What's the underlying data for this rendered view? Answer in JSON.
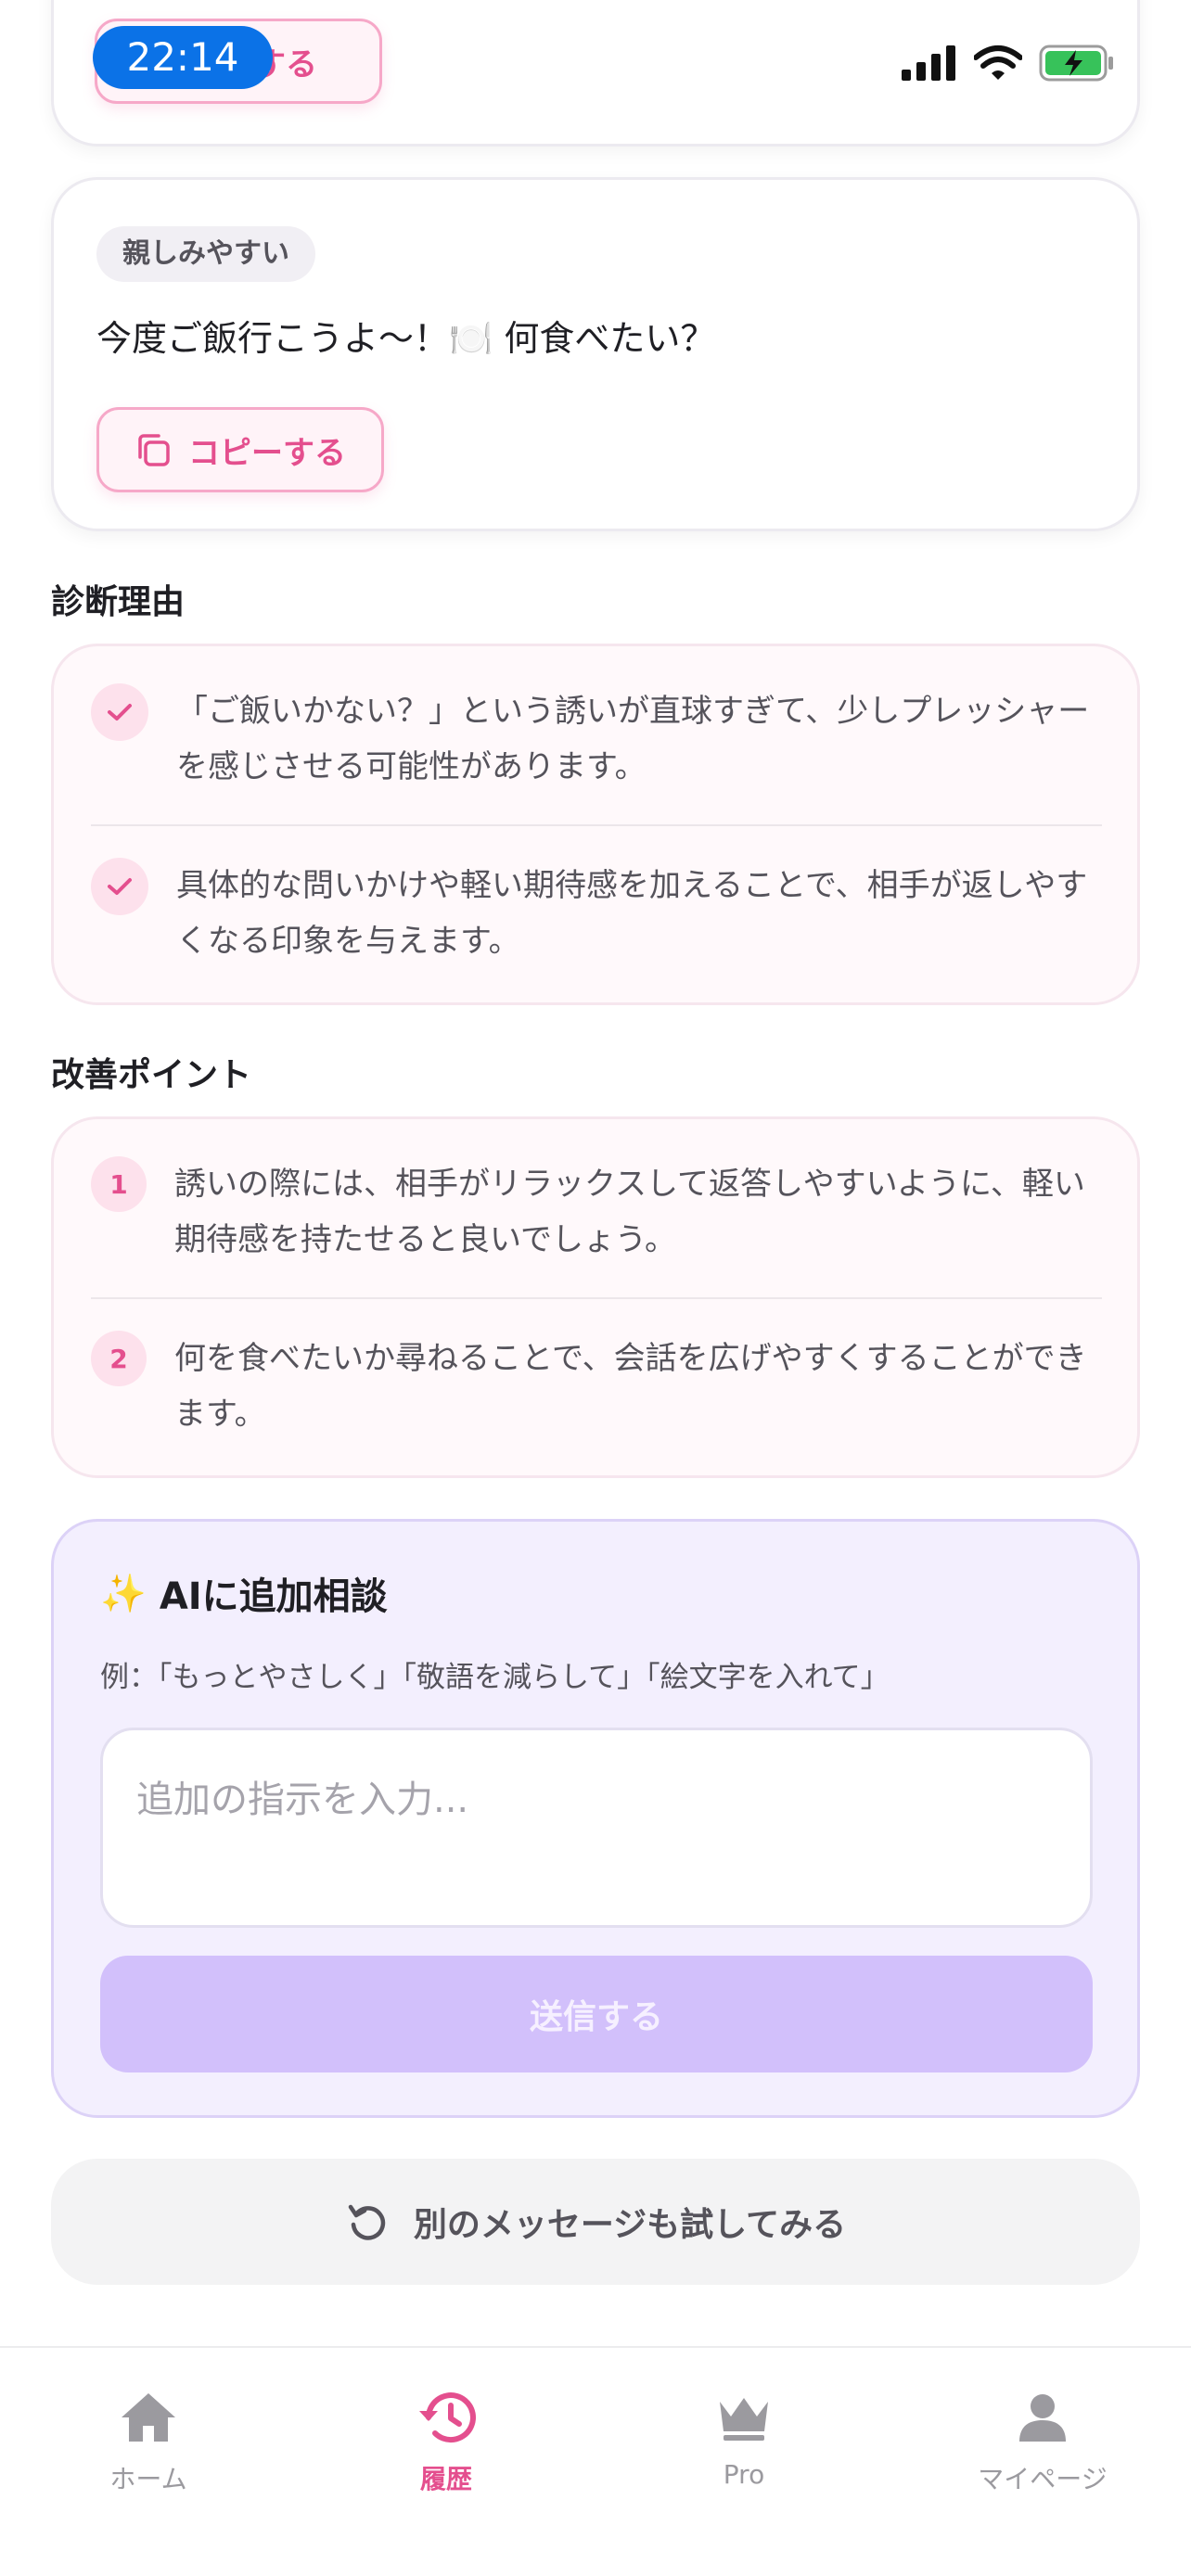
{
  "status": {
    "time": "22:14"
  },
  "top_card": {
    "copy_label": "コピーする"
  },
  "suggestion_card": {
    "tag": "親しみやすい",
    "message": "今度ご飯行こうよ〜！🍽️ 何食べたい？",
    "copy_label": "コピーする"
  },
  "reasons": {
    "title": "診断理由",
    "items": [
      "「ご飯いかない？」という誘いが直球すぎて、少しプレッシャーを感じさせる可能性があります。",
      "具体的な問いかけや軽い期待感を加えることで、相手が返しやすくなる印象を与えます。"
    ]
  },
  "improvements": {
    "title": "改善ポイント",
    "items": [
      {
        "num": "1",
        "text": "誘いの際には、相手がリラックスして返答しやすいように、軽い期待感を持たせると良いでしょう。"
      },
      {
        "num": "2",
        "text": "何を食べたいか尋ねることで、会話を広げやすくすることができます。"
      }
    ]
  },
  "ai": {
    "title": "AIに追加相談",
    "emoji": "✨",
    "examples": "例：「もっとやさしく」「敬語を減らして」「絵文字を入れて」",
    "placeholder": "追加の指示を入力...",
    "send_label": "送信する"
  },
  "retry_label": "別のメッセージも試してみる",
  "tabs": [
    {
      "label": "ホーム",
      "icon": "home-icon",
      "active": false
    },
    {
      "label": "履歴",
      "icon": "history-icon",
      "active": true
    },
    {
      "label": "Pro",
      "icon": "crown-icon",
      "active": false
    },
    {
      "label": "マイページ",
      "icon": "person-icon",
      "active": false
    }
  ],
  "colors": {
    "accent_pink": "#e44f8e",
    "accent_purple": "#d2c0fb",
    "status_blue": "#0b72e7"
  }
}
